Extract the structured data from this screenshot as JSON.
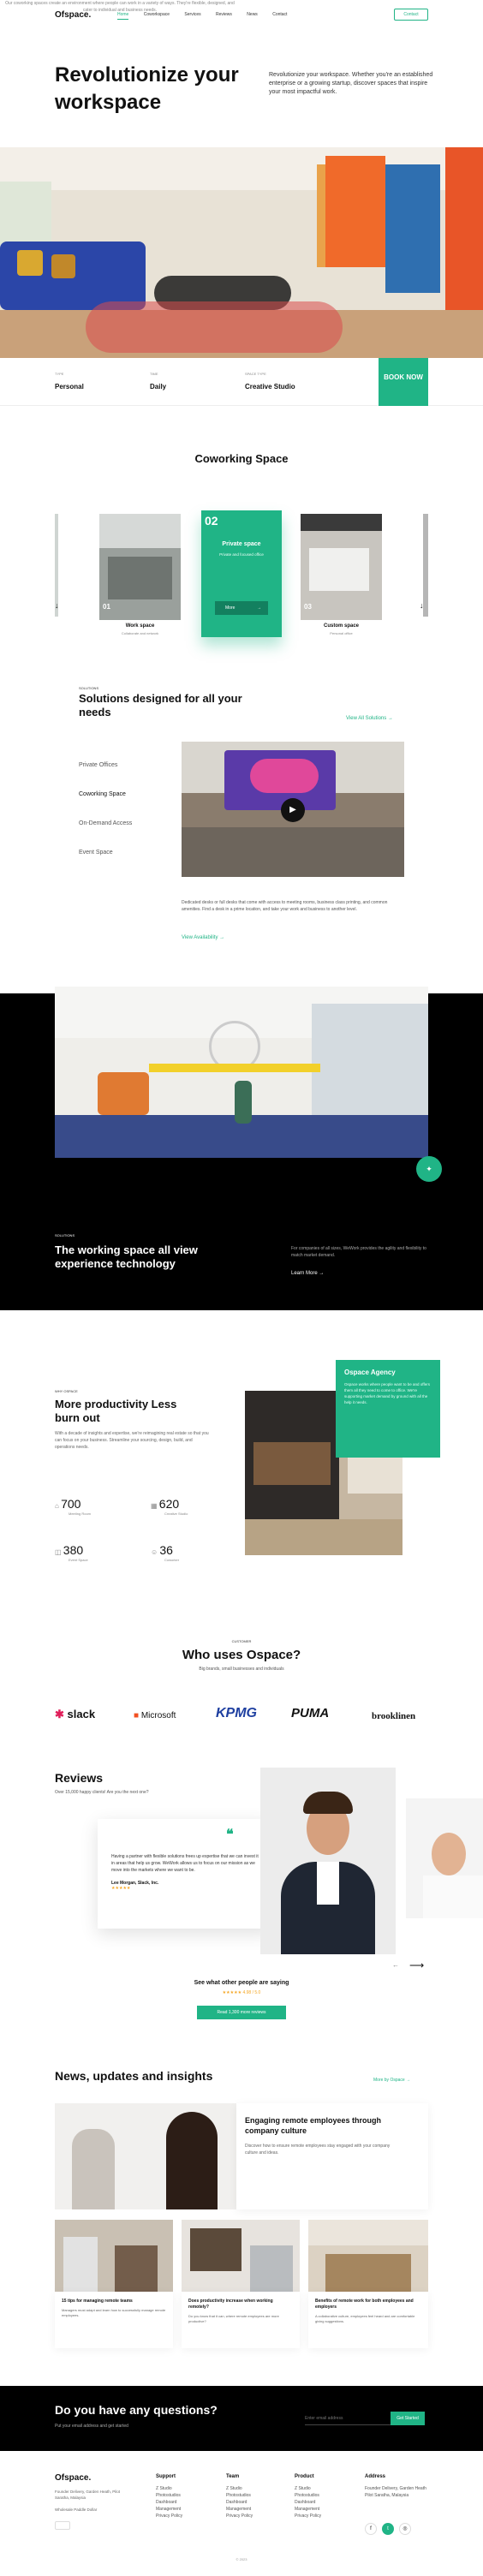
{
  "nav": {
    "logo": "Ofspace.",
    "links": [
      "Home",
      "Coworkspace",
      "Services",
      "Reviews",
      "News",
      "Contact"
    ],
    "cta": "Contact"
  },
  "hero": {
    "title": "Revolutionize your workspace",
    "desc": "Revolutionize your workspace. Whether you're an established enterprise or a growing startup, discover spaces that inspire your most impactful work."
  },
  "search": {
    "fields": [
      {
        "label": "TYPE",
        "value": "Personal"
      },
      {
        "label": "TIME",
        "value": "Daily"
      },
      {
        "label": "SPACE TYPE",
        "value": "Creative Studio"
      }
    ],
    "book": "BOOK NOW"
  },
  "coworking": {
    "title": "Coworking Space",
    "subtitle": "Our coworking spaces create an environment where people can work in a variety of ways. They're flexible, designed, and cater to individual and business needs.",
    "cards": [
      {
        "num": "01",
        "title": "Work space",
        "sub": "Collaborate and network"
      },
      {
        "num": "02",
        "title": "Private space",
        "sub": "Private and focused office",
        "btn": "More"
      },
      {
        "num": "03",
        "title": "Custom space",
        "sub": "Personal office"
      }
    ]
  },
  "solutions": {
    "kicker": "SOLUTIONS",
    "title": "Solutions designed for all your needs",
    "link": "View All Solutions",
    "items": [
      "Private Offices",
      "Coworking Space",
      "On-Demand Access",
      "Event Space"
    ],
    "desc": "Dedicated desks or full desks that come with access to meeting rooms, business class printing, and common amenities. Find a desk in a prime location, and take your work and business to another level.",
    "availability": "View Availability"
  },
  "experience": {
    "kicker": "SOLUTIONS",
    "title": "The working space all view experience technology",
    "desc": "For companies of all sizes, WeWork provides the agility and flexibility to match market demand.",
    "learn": "Learn More"
  },
  "productivity": {
    "kicker": "WHY OSPACE",
    "title": "More productivity Less burn out",
    "desc": "With a decade of insights and expertise, we're reimagining real estate so that you can focus on your business. Streamline your sourcing, design, build, and operations needs.",
    "stats": [
      {
        "value": "700",
        "label": "Meeting Room"
      },
      {
        "value": "620",
        "label": "Creative Studio"
      },
      {
        "value": "380",
        "label": "Event Space"
      },
      {
        "value": "36",
        "label": "Coworker"
      }
    ],
    "agency_title": "Ospace Agency",
    "agency_desc": "Ospace works where people want to be and offers them all they need to come to office. We're supporting market demand by ground with all the help it needs."
  },
  "clients": {
    "kicker": "CUSTOMER",
    "title": "Who uses Ospace?",
    "sub": "Big brands, small businesses and individuals",
    "logos": [
      "slack",
      "Microsoft",
      "KPMG",
      "PUMA",
      "brooklinen"
    ]
  },
  "reviews": {
    "title": "Reviews",
    "sub": "Over 15,000 happy clients! Are you the next one?",
    "quote": "Having a partner with flexible solutions frees up expertise that we can invest it in areas that help us grow. WeWork allows us to focus on our mission as we move into the markets where we want to be.",
    "author": "Lee Morgan, Slack, Inc.",
    "stars": "★★★★★",
    "see": "See what other people are saying",
    "rating": "★★★★★ 4.98 / 5.0",
    "btn": "Read 1,300 more reviews"
  },
  "news": {
    "title": "News, updates and insights",
    "more": "More by Ospace",
    "feature_title": "Engaging remote employees through company culture",
    "feature_desc": "Discover how to ensure remote employees stay engaged with your company culture and ideas.",
    "cards": [
      {
        "title": "15 tips for managing remote teams",
        "desc": "Managers must adapt and learn how to successfully manage remote employees."
      },
      {
        "title": "Does productivity increase when working remotely?",
        "desc": "Do you know that it can, where remote employees are more productive?"
      },
      {
        "title": "Benefits of remote work for both employees and employers",
        "desc": "A collaborative culture, employees feel heard and are comfortable giving suggestions."
      }
    ]
  },
  "newsletter": {
    "title": "Do you have any questions?",
    "sub": "Put your email address and get started",
    "placeholder": "Enter email address",
    "btn": "Get Started"
  },
  "footer": {
    "logo": "Ofspace.",
    "address": "Founder Delivery, Garden Heath, Pilot Saratha, Malaysia",
    "phone": "Wholesale Paddle Dollar",
    "support": {
      "title": "Support",
      "items": [
        "Z Studio",
        "Photostudios",
        "Dashboard",
        "Management",
        "Privacy Policy"
      ]
    },
    "team": {
      "title": "Team",
      "items": [
        "Z Studio",
        "Photostudios",
        "Dashboard",
        "Management",
        "Privacy Policy"
      ]
    },
    "product": {
      "title": "Product",
      "items": [
        "Z Studio",
        "Photostudios",
        "Dashboard",
        "Management",
        "Privacy Policy"
      ]
    },
    "address_col": {
      "title": "Address",
      "items": [
        "Founder Delivery, Garden Heath",
        "Pilot Saratha, Malaysia"
      ]
    },
    "copyright": "© 2023"
  },
  "colors": {
    "accent": "#20b486",
    "dark": "#000000"
  }
}
